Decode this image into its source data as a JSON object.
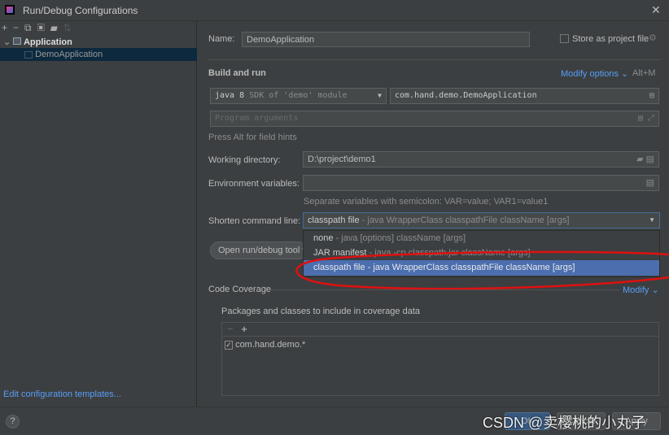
{
  "title": "Run/Debug Configurations",
  "toolbar": {
    "icons": [
      "plus-icon",
      "minus-icon",
      "copy-icon",
      "save-icon",
      "folder-icon",
      "sort-icon"
    ]
  },
  "tree": {
    "group": "Application",
    "item": "DemoApplication"
  },
  "edit_templates": "Edit configuration templates...",
  "name_label": "Name:",
  "name_value": "DemoApplication",
  "store_label": "Store as project file",
  "build_run": "Build and run",
  "modify_options": "Modify options",
  "modify_shortcut": "Alt+M",
  "sdk": {
    "bold": "java 8",
    "rest": "SDK of 'demo' module"
  },
  "main_class": "com.hand.demo.DemoApplication",
  "program_args_placeholder": "Program arguments",
  "hint": "Press Alt for field hints",
  "working_dir_label": "Working directory:",
  "working_dir": "D:\\project\\demo1",
  "env_label": "Environment variables:",
  "env_hint": "Separate variables with semicolon: VAR=value; VAR1=value1",
  "shorten_label": "Shorten command line:",
  "shorten_selected": {
    "name": "classpath file",
    "desc": " - java WrapperClass classpathFile className [args]"
  },
  "options": [
    {
      "name": "none",
      "desc": " - java [options] className [args]"
    },
    {
      "name": "JAR manifest",
      "desc": " - java -cp classpath.jar className [args]"
    },
    {
      "name": "classpath file",
      "desc": " - java WrapperClass classpathFile className [args]"
    }
  ],
  "open_tool": "Open run/debug tool window",
  "code_coverage": "Code Coverage",
  "modify": "Modify",
  "packages_label": "Packages and classes to include in coverage data",
  "package_item": "com.hand.demo.*",
  "ok": "OK",
  "cancel": "Cancel",
  "apply": "Apply",
  "watermark": "CSDN @卖樱桃的小丸子",
  "colors": {
    "accent": "#589df6",
    "selected": "#4b6eaf",
    "annotation": "#e01010"
  }
}
